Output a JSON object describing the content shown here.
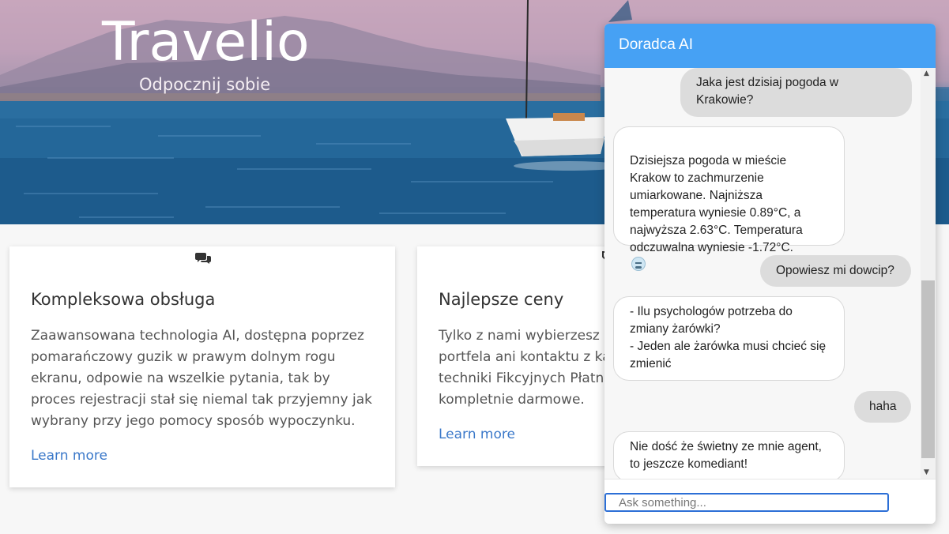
{
  "hero": {
    "brand": "Travelio",
    "tagline": "Odpocznij sobie"
  },
  "features": [
    {
      "icon": "comments-icon",
      "title": "Kompleksowa obsługa",
      "text": "Zaawansowana technologia AI, dostępna poprzez pomarańczowy guzik w prawym dolnym rogu ekranu, odpowie na wszelkie pytania, tak by proces rejestracji stał się niemal tak przyjemny jak wybrany przy jego pomocy sposób wypoczynku.",
      "link": "Learn more"
    },
    {
      "icon": "tag-icon",
      "title": "Najlepsze ceny",
      "text": "Tylko z nami wybierzesz się w podróż, nie używając portfela ani kontaktu z kasą - dzięki opatentowej techniki Fikcyjnych Płatności, ceny naszej oferty są kompletnie darmowe.",
      "link": "Learn more"
    }
  ],
  "chat": {
    "title": "Doradca AI",
    "messages": [
      {
        "role": "user",
        "text": "Jaka jest dzisiaj pogoda w\nKrakowie?"
      },
      {
        "role": "bot",
        "text": "Dzisiejsza pogoda w mieście\nKrakow to zachmurzenie\numiarkowane. Najniższa\ntemperatura wyniesie 0.89°C, a\nnajwyższa 2.63°C. Temperatura\nodczuwalna wyniesie -1.72°C.",
        "emoji": "cold-face-emoji"
      },
      {
        "role": "user",
        "text": "Opowiesz mi dowcip?"
      },
      {
        "role": "bot",
        "text": "- Ilu psychologów potrzeba do\nzmiany żarówki?\n- Jeden ale żarówka musi chcieć się\nzmienić"
      },
      {
        "role": "user",
        "text": "haha"
      },
      {
        "role": "bot",
        "text": "Nie dość że świetny ze mnie agent,\nto jeszcze komediant!"
      }
    ],
    "input_placeholder": "Ask something...",
    "input_value": "",
    "accent": "#46a1f4"
  }
}
